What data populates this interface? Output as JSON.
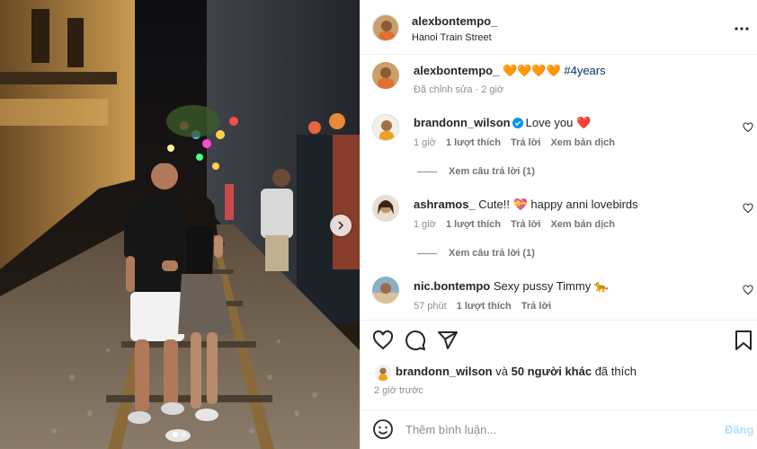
{
  "post": {
    "author": "alexbontempo_",
    "location": "Hanoi Train Street",
    "caption_emojis": "🧡🧡🧡🧡",
    "caption_hashtag": "#4years",
    "caption_meta": "Đã chỉnh sửa · 2 giờ"
  },
  "comments": [
    {
      "user": "brandonn_wilson",
      "verified": true,
      "text": "Love you ❤️",
      "time": "1 giờ",
      "likes": "1 lượt thích",
      "reply": "Trả lời",
      "translate": "Xem bản dịch",
      "replies": "Xem câu trả lời (1)"
    },
    {
      "user": "ashramos_",
      "verified": false,
      "text": "Cute!! 💝 happy anni lovebirds",
      "time": "1 giờ",
      "likes": "1 lượt thích",
      "reply": "Trả lời",
      "translate": "Xem bản dịch",
      "replies": "Xem câu trả lời (1)"
    },
    {
      "user": "nic.bontempo",
      "verified": false,
      "text": "Sexy pussy Timmy 🐆",
      "time": "57 phút",
      "likes": "1 lượt thích",
      "reply": "Trả lời"
    }
  ],
  "likes_line": {
    "user": "brandonn_wilson",
    "connector": "và",
    "others": "50 người khác",
    "suffix": "đã thích"
  },
  "timestamp": "2 giờ trước",
  "composer": {
    "placeholder": "Thêm bình luận...",
    "post_label": "Đăng"
  },
  "carousel": {
    "slides": 2,
    "current": 1
  },
  "icons": {
    "more": "more-horizontal-icon",
    "like": "heart-icon",
    "comment": "comment-bubble-icon",
    "share": "paper-plane-icon",
    "save": "bookmark-icon",
    "emoji": "smiley-icon",
    "next": "chevron-right-icon",
    "verified": "verified-badge-icon"
  },
  "colors": {
    "link": "#00376b",
    "verified": "#0095f6",
    "post_disabled": "#b2dffc",
    "muted": "#8e8e8e"
  }
}
